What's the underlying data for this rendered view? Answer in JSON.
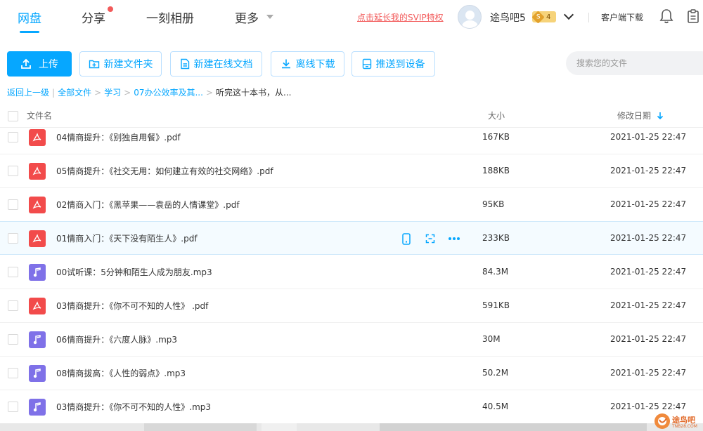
{
  "nav": {
    "tabs": [
      {
        "label": "网盘",
        "active": true
      },
      {
        "label": "分享",
        "has_dot": true
      },
      {
        "label": "一刻相册"
      },
      {
        "label": "更多"
      }
    ],
    "svip_link": "点击延长我的SVIP特权",
    "username": "途鸟吧5",
    "vip_level": "4",
    "vip_letter": "S",
    "client_download": "客户端下载"
  },
  "toolbar": {
    "upload": "上传",
    "new_folder": "新建文件夹",
    "new_online_doc": "新建在线文档",
    "offline_download": "离线下载",
    "push_to_device": "推送到设备",
    "search_placeholder": "搜索您的文件"
  },
  "breadcrumb": {
    "back": "返回上一级",
    "items": [
      "全部文件",
      "学习",
      "07办公效率及其..."
    ],
    "current": "听完这十本书，从..."
  },
  "table": {
    "headers": {
      "name": "文件名",
      "size": "大小",
      "date": "修改日期"
    },
    "rows": [
      {
        "type": "pdf",
        "name": "04情商提升：《别独自用餐》.pdf",
        "size": "167KB",
        "date": "2021-01-25 22:47"
      },
      {
        "type": "pdf",
        "name": "05情商提升：《社交无用：如何建立有效的社交网络》.pdf",
        "size": "188KB",
        "date": "2021-01-25 22:47"
      },
      {
        "type": "pdf",
        "name": "02情商入门：《黑苹果——袁岳的人情课堂》.pdf",
        "size": "95KB",
        "date": "2021-01-25 22:47"
      },
      {
        "type": "pdf",
        "name": "01情商入门：《天下没有陌生人》.pdf",
        "size": "233KB",
        "date": "2021-01-25 22:47",
        "hover": true
      },
      {
        "type": "mp3",
        "name": "00试听课：5分钟和陌生人成为朋友.mp3",
        "size": "84.3M",
        "date": "2021-01-25 22:47"
      },
      {
        "type": "pdf",
        "name": "03情商提升：《你不可不知的人性》 .pdf",
        "size": "591KB",
        "date": "2021-01-25 22:47"
      },
      {
        "type": "mp3",
        "name": "06情商提升：《六度人脉》.mp3",
        "size": "30M",
        "date": "2021-01-25 22:47"
      },
      {
        "type": "mp3",
        "name": "08情商拔高：《人性的弱点》.mp3",
        "size": "50.2M",
        "date": "2021-01-25 22:47"
      },
      {
        "type": "mp3",
        "name": "03情商提升：《你不可不知的人性》.mp3",
        "size": "40.5M",
        "date": "2021-01-25 22:47"
      }
    ]
  },
  "watermark": {
    "text": "途鸟吧",
    "sub": "TNB28.COM"
  },
  "colors": {
    "accent": "#06a7ff",
    "pdf": "#f24b4b",
    "mp3": "#7f71e8",
    "svip": "#f25a5a"
  }
}
